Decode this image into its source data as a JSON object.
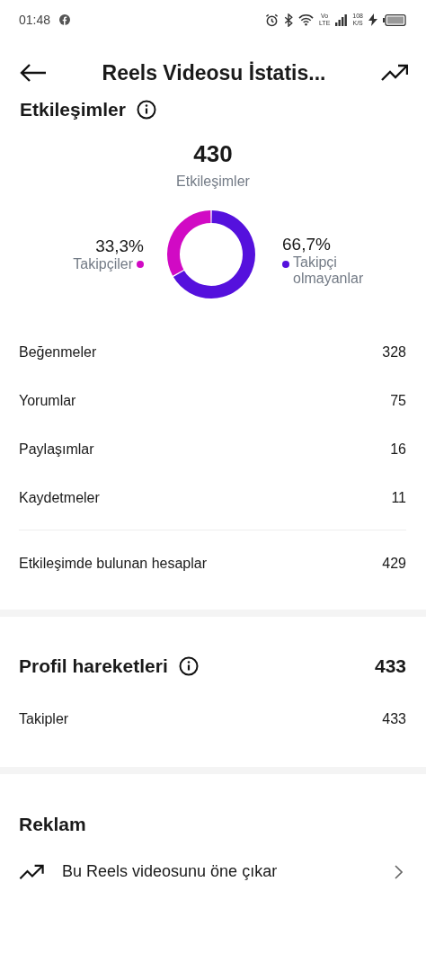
{
  "status_bar": {
    "time": "01:48",
    "network_speed_value": "108",
    "network_speed_unit": "K/S",
    "network_label_top": "Vo",
    "network_label_bottom": "LTE"
  },
  "header": {
    "title": "Reels Videosu İstatis..."
  },
  "interactions": {
    "section_title": "Etkileşimler",
    "total": "430",
    "total_label": "Etkileşimler",
    "legend": [
      {
        "percent": "33,3%",
        "color": "#d10ac4"
      },
      {
        "percent": "66,7%",
        "color": "#5511dd"
      }
    ],
    "chart_data": {
      "type": "donut",
      "categories": [
        "Takipçiler",
        "Takipçi olmayanlar"
      ],
      "values": [
        33.3,
        66.7
      ]
    },
    "rows": [
      {
        "label": "Beğenmeler",
        "value": "328"
      },
      {
        "label": "Yorumlar",
        "value": "75"
      },
      {
        "label": "Paylaşımlar",
        "value": "16"
      },
      {
        "label": "Kaydetmeler",
        "value": "11"
      }
    ],
    "accounts": {
      "label": "Etkileşimde bulunan hesaplar",
      "value": "429"
    }
  },
  "profile": {
    "title": "Profil hareketleri",
    "value": "433",
    "rows": [
      {
        "label": "Takipler",
        "value": "433"
      }
    ]
  },
  "ads": {
    "title": "Reklam",
    "action": "Bu Reels videosunu öne çıkar"
  }
}
